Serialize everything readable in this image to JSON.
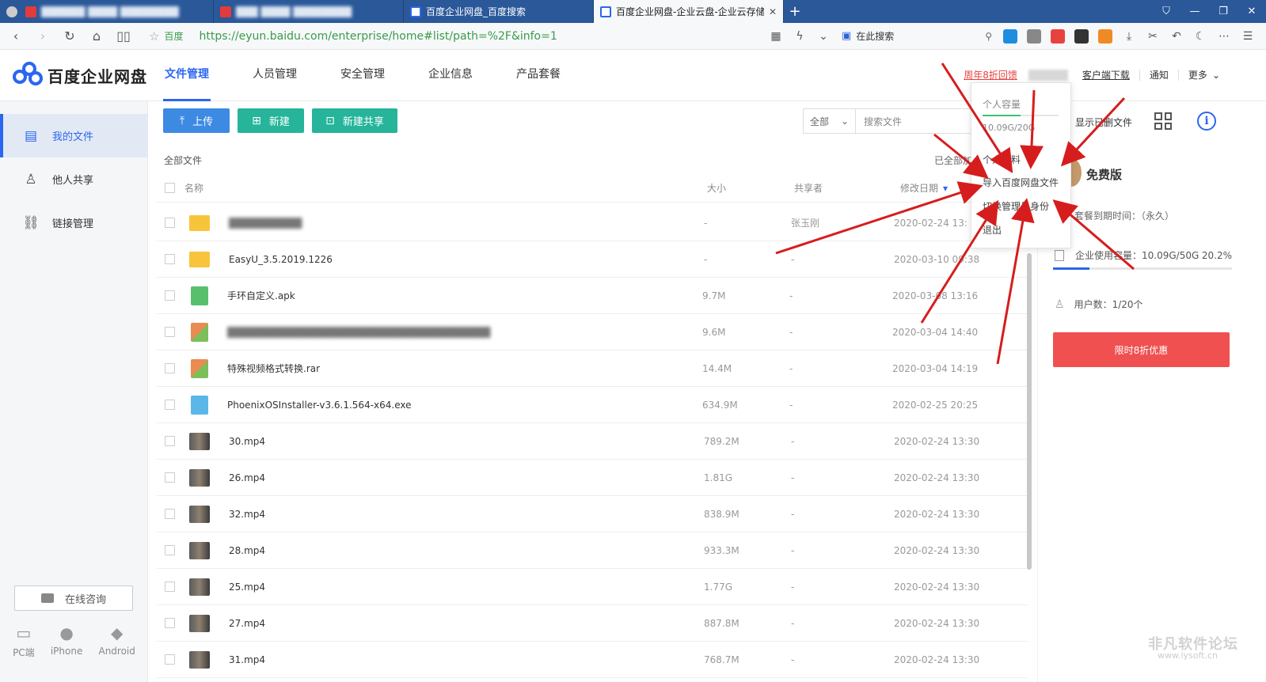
{
  "browser": {
    "tabs": [
      {
        "title": "██████ ████ ████████",
        "blurred": true,
        "favicon_color": "#e23b3b"
      },
      {
        "title": "███ ████ ████████",
        "blurred": true,
        "favicon_color": "#e23b3b"
      },
      {
        "title": "百度企业网盘_百度搜索",
        "blurred": false,
        "favicon_color": "#2b66f0"
      },
      {
        "title": "百度企业网盘-企业云盘-企业云存储",
        "blurred": false,
        "favicon_color": "#2b66f0",
        "active": true
      }
    ],
    "address": {
      "site_label": "百度",
      "url": "https://eyun.baidu.com/enterprise/home#list/path=%2F&info=1",
      "search_placeholder": "在此搜索"
    }
  },
  "app": {
    "brand": "百度企业网盘",
    "nav": [
      {
        "label": "文件管理",
        "active": true
      },
      {
        "label": "人员管理"
      },
      {
        "label": "安全管理"
      },
      {
        "label": "企业信息"
      },
      {
        "label": "产品套餐"
      }
    ],
    "header_right": {
      "promo": "周年8折回馈",
      "client_download": "客户端下载",
      "notify": "通知",
      "more": "更多"
    }
  },
  "sidebar": {
    "items": [
      {
        "label": "我的文件",
        "active": true
      },
      {
        "label": "他人共享"
      },
      {
        "label": "链接管理"
      }
    ],
    "consult": "在线咨询",
    "platforms": [
      "PC端",
      "iPhone",
      "Android"
    ]
  },
  "toolbar": {
    "upload": "上传",
    "new": "新建",
    "new_share": "新建共享",
    "filter_all": "全部",
    "search_placeholder": "搜索文件"
  },
  "breadcrumb": "全部文件",
  "loaded_text": "已全部加",
  "table": {
    "headers": {
      "name": "名称",
      "size": "大小",
      "sharer": "共享者",
      "date": "修改日期"
    },
    "rows": [
      {
        "name": "██████████",
        "blurred": true,
        "size": "-",
        "sharer": "张玉刚",
        "date": "2020-02-24 13:",
        "type": "folder"
      },
      {
        "name": "EasyU_3.5.2019.1226",
        "size": "-",
        "sharer": "-",
        "date": "2020-03-10 09:38",
        "type": "folder"
      },
      {
        "name": "手环自定义.apk",
        "size": "9.7M",
        "sharer": "-",
        "date": "2020-03-08 13:16",
        "type": "apk"
      },
      {
        "name": "████████████████████████████████████",
        "blurred": true,
        "size": "9.6M",
        "sharer": "-",
        "date": "2020-03-04 14:40",
        "type": "rar"
      },
      {
        "name": "特殊视频格式转换.rar",
        "size": "14.4M",
        "sharer": "-",
        "date": "2020-03-04 14:19",
        "type": "rar"
      },
      {
        "name": "PhoenixOSInstaller-v3.6.1.564-x64.exe",
        "size": "634.9M",
        "sharer": "-",
        "date": "2020-02-25 20:25",
        "type": "exe"
      },
      {
        "name": "30.mp4",
        "size": "789.2M",
        "sharer": "-",
        "date": "2020-02-24 13:30",
        "type": "video"
      },
      {
        "name": "26.mp4",
        "size": "1.81G",
        "sharer": "-",
        "date": "2020-02-24 13:30",
        "type": "video"
      },
      {
        "name": "32.mp4",
        "size": "838.9M",
        "sharer": "-",
        "date": "2020-02-24 13:30",
        "type": "video"
      },
      {
        "name": "28.mp4",
        "size": "933.3M",
        "sharer": "-",
        "date": "2020-02-24 13:30",
        "type": "video"
      },
      {
        "name": "25.mp4",
        "size": "1.77G",
        "sharer": "-",
        "date": "2020-02-24 13:30",
        "type": "video"
      },
      {
        "name": "27.mp4",
        "size": "887.8M",
        "sharer": "-",
        "date": "2020-02-24 13:30",
        "type": "video"
      },
      {
        "name": "31.mp4",
        "size": "768.7M",
        "sharer": "-",
        "date": "2020-02-24 13:30",
        "type": "video"
      }
    ]
  },
  "right_panel": {
    "show_files": "显示已删文件",
    "edition": "免费版",
    "expire": "套餐到期时间：（永久）",
    "usage_label": "企业使用容量：10.09G/50G",
    "usage_pct": "20.2%",
    "usage_fraction": 0.202,
    "users": "用户数：1/20个",
    "promo_button": "限时8折优惠"
  },
  "dropdown": {
    "caption": "个人容量",
    "value": "10.09G/20G",
    "fraction": 0.5,
    "items": [
      "个人资料",
      "导入百度网盘文件",
      "切换管理员身份",
      "退出"
    ]
  },
  "watermark": "非凡软件论坛",
  "watermark_url": "www.iysoft.cn",
  "colors": {
    "primary": "#2b66f0",
    "upload": "#3d8ae3",
    "green": "#26b49a",
    "promo_red": "#f05050",
    "arrow_red": "#d61d1d"
  }
}
